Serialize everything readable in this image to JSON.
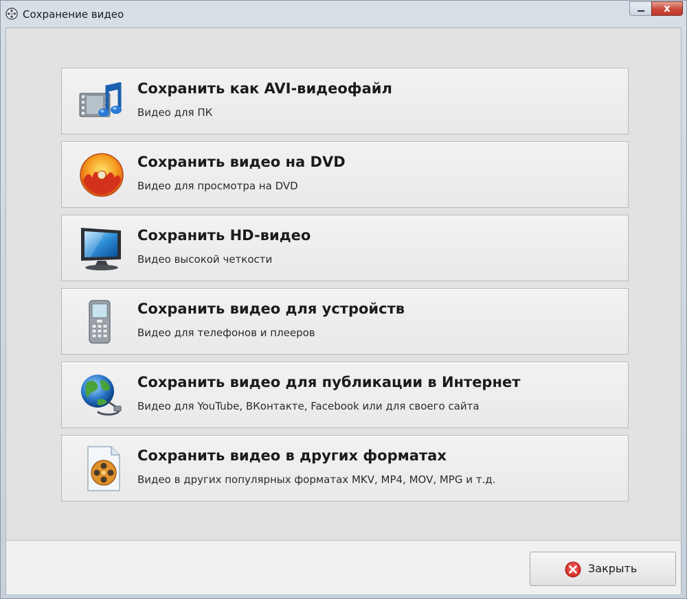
{
  "window": {
    "title": "Сохранение видео",
    "minimize_symbol": "",
    "close_symbol": "x"
  },
  "options": [
    {
      "icon": "film-music-icon",
      "title": "Сохранить как AVI-видеофайл",
      "subtitle": "Видео для ПК"
    },
    {
      "icon": "dvd-disc-icon",
      "title": "Сохранить видео на DVD",
      "subtitle": "Видео для просмотра на DVD"
    },
    {
      "icon": "hd-tv-icon",
      "title": "Сохранить HD-видео",
      "subtitle": "Видео высокой четкости"
    },
    {
      "icon": "mobile-phone-icon",
      "title": "Сохранить видео для устройств",
      "subtitle": "Видео для телефонов и плееров"
    },
    {
      "icon": "globe-cable-icon",
      "title": "Сохранить видео для публикации в Интернет",
      "subtitle": "Видео для YouTube, ВКонтакте, Facebook или для своего сайта"
    },
    {
      "icon": "film-reel-file-icon",
      "title": "Сохранить видео в других форматах",
      "subtitle": "Видео в других популярных форматах MKV, MP4, MOV, MPG и т.д."
    }
  ],
  "footer": {
    "close_label": "Закрыть"
  },
  "colors": {
    "close_red": "#d9312b",
    "option_background": "#eeeeee",
    "client_background": "#e2e2e2"
  }
}
